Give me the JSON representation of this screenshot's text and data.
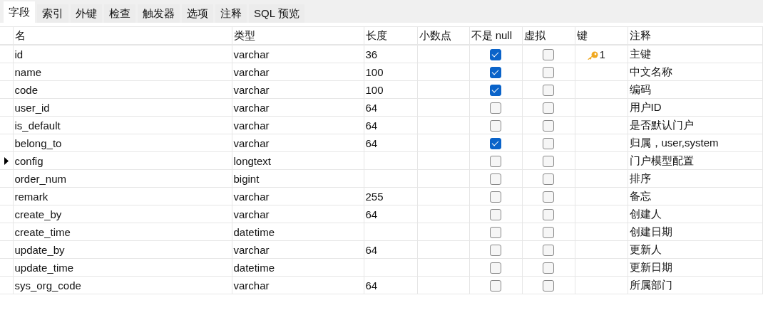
{
  "tabs": [
    {
      "label": "字段",
      "selected": true
    },
    {
      "label": "索引",
      "selected": false
    },
    {
      "label": "外键",
      "selected": false
    },
    {
      "label": "检查",
      "selected": false
    },
    {
      "label": "触发器",
      "selected": false
    },
    {
      "label": "选项",
      "selected": false
    },
    {
      "label": "注释",
      "selected": false
    },
    {
      "label": "SQL 预览",
      "selected": false
    }
  ],
  "table": {
    "columns": [
      "名",
      "类型",
      "长度",
      "小数点",
      "不是 null",
      "虚拟",
      "键",
      "注释"
    ],
    "rows": [
      {
        "name": "id",
        "type": "varchar",
        "length": "36",
        "not_null": true,
        "virtual": false,
        "key": "1",
        "comment": "主键",
        "current": false
      },
      {
        "name": "name",
        "type": "varchar",
        "length": "100",
        "not_null": true,
        "virtual": false,
        "comment": "中文名称",
        "current": false
      },
      {
        "name": "code",
        "type": "varchar",
        "length": "100",
        "not_null": true,
        "virtual": false,
        "comment": "编码",
        "current": false
      },
      {
        "name": "user_id",
        "type": "varchar",
        "length": "64",
        "not_null": false,
        "virtual": false,
        "comment": "用户ID",
        "current": false
      },
      {
        "name": "is_default",
        "type": "varchar",
        "length": "64",
        "not_null": false,
        "virtual": false,
        "comment": "是否默认门户",
        "current": false
      },
      {
        "name": "belong_to",
        "type": "varchar",
        "length": "64",
        "not_null": true,
        "virtual": false,
        "comment": "归属，user,system",
        "current": false
      },
      {
        "name": "config",
        "type": "longtext",
        "not_null": false,
        "virtual": false,
        "comment": "门户模型配置",
        "current": true
      },
      {
        "name": "order_num",
        "type": "bigint",
        "not_null": false,
        "virtual": false,
        "comment": "排序",
        "current": false
      },
      {
        "name": "remark",
        "type": "varchar",
        "length": "255",
        "not_null": false,
        "virtual": false,
        "comment": "备忘",
        "current": false
      },
      {
        "name": "create_by",
        "type": "varchar",
        "length": "64",
        "not_null": false,
        "virtual": false,
        "comment": "创建人",
        "current": false
      },
      {
        "name": "create_time",
        "type": "datetime",
        "not_null": false,
        "virtual": false,
        "comment": "创建日期",
        "current": false
      },
      {
        "name": "update_by",
        "type": "varchar",
        "length": "64",
        "not_null": false,
        "virtual": false,
        "comment": "更新人",
        "current": false
      },
      {
        "name": "update_time",
        "type": "datetime",
        "not_null": false,
        "virtual": false,
        "comment": "更新日期",
        "current": false
      },
      {
        "name": "sys_org_code",
        "type": "varchar",
        "length": "64",
        "not_null": false,
        "virtual": false,
        "comment": "所属部门",
        "current": false
      }
    ]
  }
}
